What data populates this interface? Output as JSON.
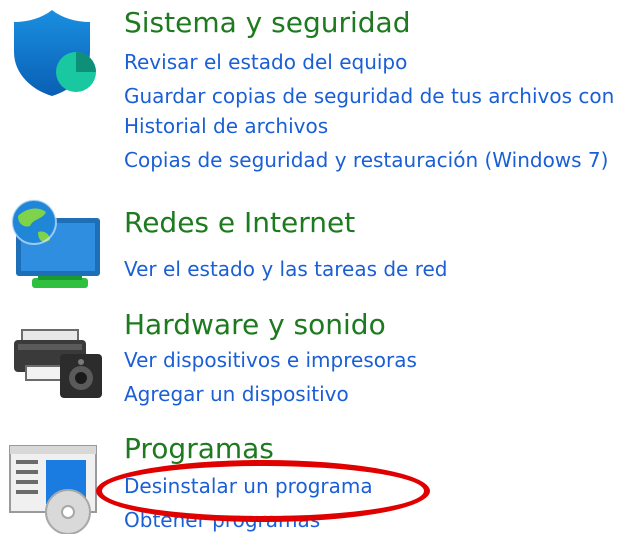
{
  "categories": [
    {
      "title": "Sistema y seguridad",
      "icon": "shield-icon",
      "links": [
        "Revisar el estado del equipo",
        "Guardar copias de seguridad de tus archivos con",
        "Historial de archivos",
        "Copias de seguridad y restauración (Windows 7)"
      ]
    },
    {
      "title": "Redes e Internet",
      "icon": "network-globe-icon",
      "links": [
        "Ver el estado y las tareas de red"
      ]
    },
    {
      "title": "Hardware y sonido",
      "icon": "printer-speaker-icon",
      "links": [
        "Ver dispositivos e impresoras",
        "Agregar un dispositivo"
      ]
    },
    {
      "title": "Programas",
      "icon": "programs-disc-icon",
      "links": [
        "Desinstalar un programa",
        "Obtener programas"
      ]
    }
  ],
  "colors": {
    "title": "#1e7a1e",
    "link": "#1a5fd6",
    "highlight": "#e00000"
  }
}
